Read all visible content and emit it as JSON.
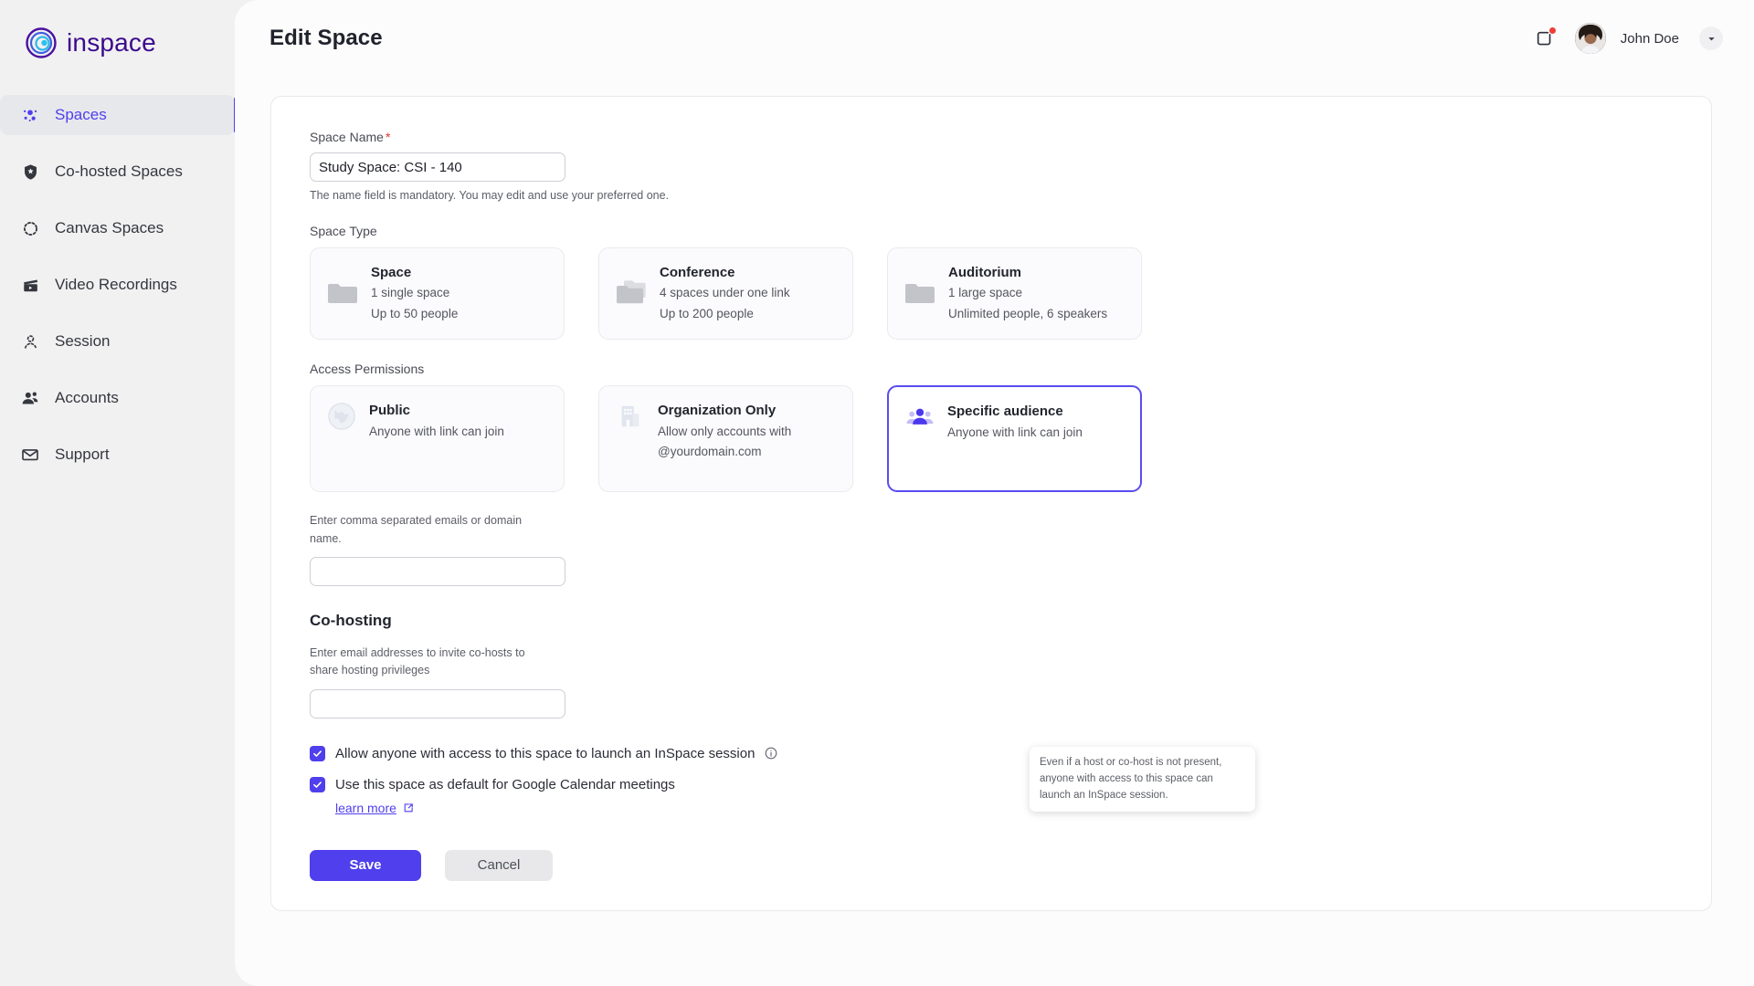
{
  "brand": {
    "name": "inspace",
    "logo_icon": "inspace-spiral-logo",
    "color": "#3b0a8c",
    "accent": "#4f3fec"
  },
  "sidebar": {
    "items": [
      {
        "label": "Spaces",
        "icon": "spaces-dots-icon",
        "active": true
      },
      {
        "label": "Co-hosted Spaces",
        "icon": "shield-star-icon",
        "active": false
      },
      {
        "label": "Canvas Spaces",
        "icon": "canvas-circle-icon",
        "active": false
      },
      {
        "label": "Video Recordings",
        "icon": "clapperboard-icon",
        "active": false
      },
      {
        "label": "Session",
        "icon": "session-person-dashed-icon",
        "active": false
      },
      {
        "label": "Accounts",
        "icon": "accounts-people-icon",
        "active": false
      },
      {
        "label": "Support",
        "icon": "envelope-icon",
        "active": false
      }
    ]
  },
  "header": {
    "title": "Edit Space",
    "notification_icon": "notification-bell-square-icon",
    "has_notification_dot": true,
    "notification_dot_color": "#ef3d34",
    "avatar_icon": "user-avatar-photo",
    "user_name": "John Doe",
    "dropdown_icon": "chevron-down-icon"
  },
  "form": {
    "space_name": {
      "label": "Space Name",
      "required_marker": "*",
      "value": "Study Space: CSI - 140",
      "placeholder": "",
      "helper": "The name field is mandatory. You may edit and use your preferred one."
    },
    "space_type": {
      "label": "Space Type",
      "options": [
        {
          "title": "Space",
          "line1": "1 single space",
          "line2": "Up to 50 people",
          "icon": "folder-single-icon",
          "selected": false
        },
        {
          "title": "Conference",
          "line1": "4 spaces under one link",
          "line2": "Up to 200 people",
          "icon": "folder-stack-icon",
          "selected": false
        },
        {
          "title": "Auditorium",
          "line1": "1 large space",
          "line2": "Unlimited people, 6 speakers",
          "icon": "folder-single-icon",
          "selected": false
        }
      ]
    },
    "access_permissions": {
      "label": "Access Permissions",
      "options": [
        {
          "title": "Public",
          "line1": "Anyone with link can join",
          "line2": "",
          "icon": "globe-icon",
          "selected": false
        },
        {
          "title": "Organization Only",
          "line1": "Allow only accounts with",
          "line2": "@yourdomain.com",
          "icon": "building-icon",
          "selected": false
        },
        {
          "title": "Specific audience",
          "line1": "Anyone with link can join",
          "line2": "",
          "icon": "people-group-icon",
          "selected": true
        }
      ]
    },
    "audience_input": {
      "helper": "Enter comma separated emails or domain name.",
      "value": "",
      "placeholder": ""
    },
    "cohosting": {
      "title": "Co-hosting",
      "helper": "Enter email addresses to invite co-hosts to share hosting privileges",
      "value": "",
      "placeholder": ""
    },
    "checkboxes": [
      {
        "label": "Allow anyone with access to this space to launch an InSpace session",
        "checked": true,
        "info_icon": "info-circle-icon"
      },
      {
        "label": "Use this space as default for Google Calendar meetings",
        "checked": true,
        "info_icon": ""
      }
    ],
    "learn_more": {
      "label": "learn more",
      "icon": "external-link-icon"
    },
    "tooltip": {
      "text": "Even if a host or co-host is not present, anyone with access to this space can launch an InSpace session."
    },
    "buttons": {
      "save": "Save",
      "cancel": "Cancel"
    }
  }
}
